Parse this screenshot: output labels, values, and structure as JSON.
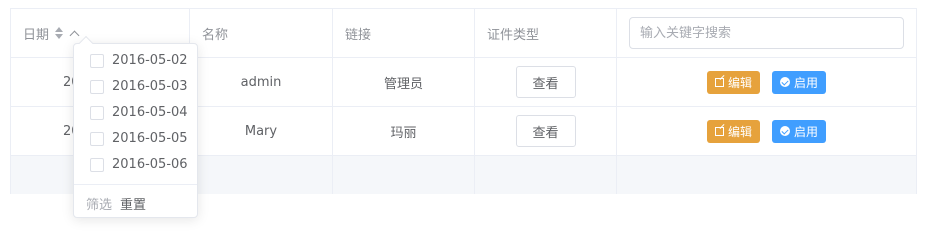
{
  "table": {
    "headers": {
      "date": "日期",
      "name": "名称",
      "link": "链接",
      "cert_type": "证件类型"
    },
    "search": {
      "placeholder": "输入关键字搜索"
    },
    "rows": [
      {
        "date_partial": "20",
        "name": "admin",
        "link": "管理员",
        "view_label": "查看",
        "edit_label": "编辑",
        "enable_label": "启用"
      },
      {
        "date_partial": "20",
        "name": "Mary",
        "link": "玛丽",
        "view_label": "查看",
        "edit_label": "编辑",
        "enable_label": "启用"
      }
    ]
  },
  "filter_dropdown": {
    "options": [
      "2016-05-02",
      "2016-05-03",
      "2016-05-04",
      "2016-05-05",
      "2016-05-06"
    ],
    "filter_label": "筛选",
    "reset_label": "重置"
  },
  "colors": {
    "edit": "#e6a23c",
    "enable": "#409eff",
    "border": "#ebeef5",
    "header_text": "#909399"
  }
}
